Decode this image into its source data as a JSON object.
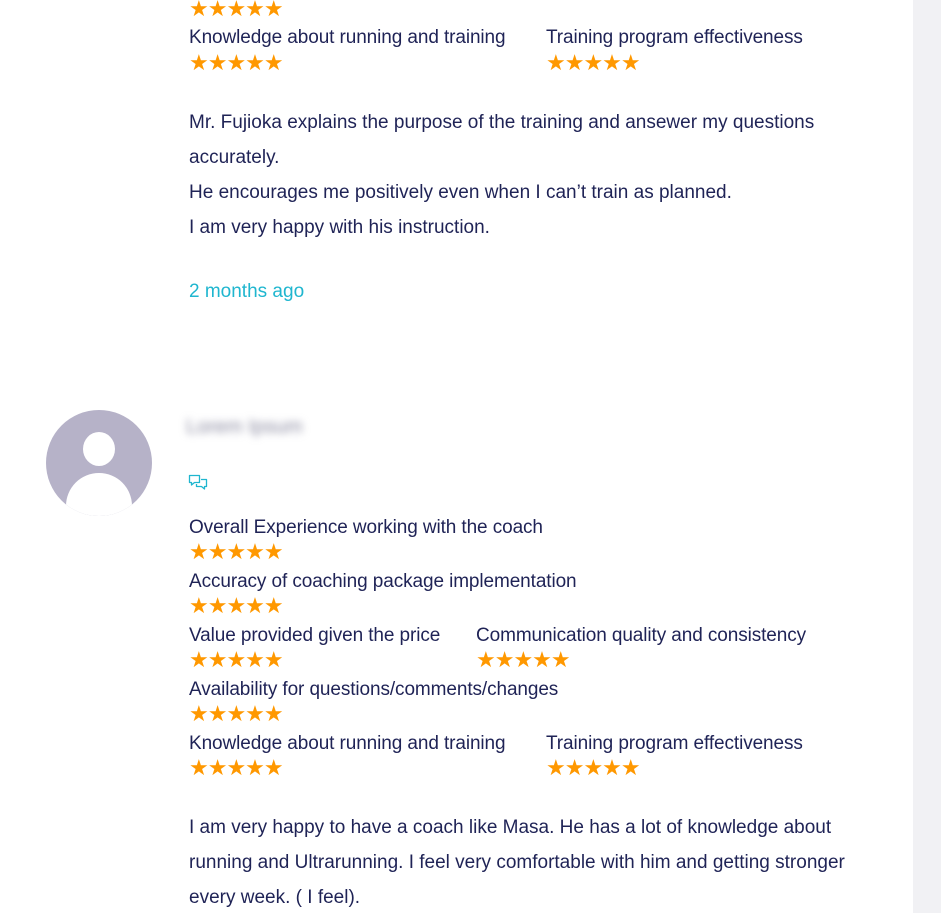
{
  "icons": {
    "star": "star-icon",
    "comment": "comment-icon",
    "avatar": "default-avatar-icon"
  },
  "colors": {
    "text": "#1f2356",
    "star": "#ff9800",
    "time_ago": "#1fb6cf",
    "avatar_bg": "#b6b2c8"
  },
  "star_glyphs": "★★★★★",
  "review1": {
    "rating_overall": 5,
    "labels": {
      "knowledge": "Knowledge about running and training",
      "effectiveness": "Training program effectiveness"
    },
    "ratings": {
      "knowledge": 5,
      "effectiveness": 5
    },
    "text": [
      "Mr. Fujioka explains the purpose of the training and ansewer my questions accurately.",
      "He encourages me positively even when I can’t train as planned.",
      "I am very happy with his instruction."
    ],
    "time_ago": "2 months ago"
  },
  "review2": {
    "reviewer_name": "Lorem Ipsum",
    "labels": {
      "overall": "Overall Experience working with the coach",
      "accuracy": "Accuracy of coaching package implementation",
      "value": "Value provided given the price",
      "communication": "Communication quality and consistency",
      "availability": "Availability for questions/comments/changes",
      "knowledge": "Knowledge about running and training",
      "effectiveness": "Training program effectiveness"
    },
    "ratings": {
      "overall": 5,
      "accuracy": 5,
      "value": 5,
      "communication": 5,
      "availability": 5,
      "knowledge": 5,
      "effectiveness": 5
    },
    "text": [
      "I am very happy to have a coach like Masa. He has a lot of knowledge about running and Ultrarunning. I feel very comfortable with him and getting stronger every week. ( I feel)."
    ]
  }
}
